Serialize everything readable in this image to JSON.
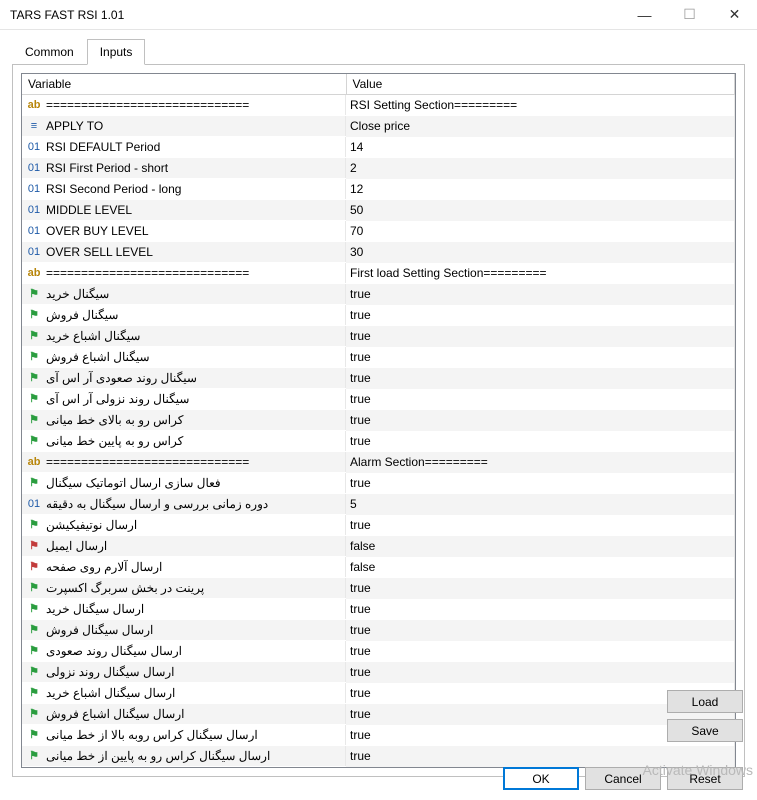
{
  "window": {
    "title": "TARS FAST RSI 1.01"
  },
  "tabs": {
    "common": "Common",
    "inputs": "Inputs"
  },
  "headers": {
    "variable": "Variable",
    "value": "Value"
  },
  "rows": [
    {
      "icon": "ab",
      "var": "=============================",
      "val": "RSI Setting Section========="
    },
    {
      "icon": "apply",
      "var": "APPLY TO",
      "val": "Close price"
    },
    {
      "icon": "01",
      "var": "RSI DEFAULT Period",
      "val": "14"
    },
    {
      "icon": "01",
      "var": "RSI First Period - short",
      "val": "2"
    },
    {
      "icon": "01",
      "var": "RSI Second Period - long",
      "val": "12"
    },
    {
      "icon": "01",
      "var": "MIDDLE LEVEL",
      "val": "50"
    },
    {
      "icon": "01",
      "var": "OVER BUY LEVEL",
      "val": "70"
    },
    {
      "icon": "01",
      "var": "OVER SELL LEVEL",
      "val": "30"
    },
    {
      "icon": "ab",
      "var": "=============================",
      "val": "First load Setting Section========="
    },
    {
      "icon": "bool",
      "var": "سیگنال خرید",
      "val": "true"
    },
    {
      "icon": "bool",
      "var": "سیگنال فروش",
      "val": "true"
    },
    {
      "icon": "bool",
      "var": "سیگنال اشباع خرید",
      "val": "true"
    },
    {
      "icon": "bool",
      "var": "سیگنال اشباع فروش",
      "val": "true"
    },
    {
      "icon": "bool",
      "var": "سیگنال روند صعودی آر اس آی",
      "val": "true"
    },
    {
      "icon": "bool",
      "var": "سیگنال روند نزولی آر اس آی",
      "val": "true"
    },
    {
      "icon": "bool",
      "var": "کراس رو به بالای خط میانی",
      "val": "true"
    },
    {
      "icon": "bool",
      "var": "کراس رو به پایین خط میانی",
      "val": "true"
    },
    {
      "icon": "ab",
      "var": "=============================",
      "val": "Alarm Section========="
    },
    {
      "icon": "bool",
      "var": "فعال سازی ارسال اتوماتیک سیگنال",
      "val": "true"
    },
    {
      "icon": "01",
      "var": "دوره زمانی بررسی و ارسال سیگنال به دقیقه",
      "val": "5"
    },
    {
      "icon": "bool",
      "var": "ارسال نوتیفیکیشن",
      "val": "true"
    },
    {
      "icon": "boolr",
      "var": "ارسال ایمیل",
      "val": "false"
    },
    {
      "icon": "boolr",
      "var": "ارسال آلارم روی صفحه",
      "val": "false"
    },
    {
      "icon": "bool",
      "var": "پرینت در بخش سربرگ اکسپرت",
      "val": "true"
    },
    {
      "icon": "bool",
      "var": "ارسال سیگنال خرید",
      "val": "true"
    },
    {
      "icon": "bool",
      "var": "ارسال سیگنال فروش",
      "val": "true"
    },
    {
      "icon": "bool",
      "var": "ارسال سیگنال روند صعودی",
      "val": "true"
    },
    {
      "icon": "bool",
      "var": "ارسال سیگنال روند نزولی",
      "val": "true"
    },
    {
      "icon": "bool",
      "var": "ارسال سیگنال اشباع خرید",
      "val": "true"
    },
    {
      "icon": "bool",
      "var": "ارسال سیگنال اشباع فروش",
      "val": "true"
    },
    {
      "icon": "bool",
      "var": "ارسال سیگنال کراس روبه بالا از خط میانی",
      "val": "true"
    },
    {
      "icon": "bool",
      "var": "ارسال سیگنال کراس رو به پایین از خط میانی",
      "val": "true"
    }
  ],
  "buttons": {
    "load": "Load",
    "save": "Save",
    "ok": "OK",
    "cancel": "Cancel",
    "reset": "Reset"
  },
  "watermark": "Activate Windows"
}
